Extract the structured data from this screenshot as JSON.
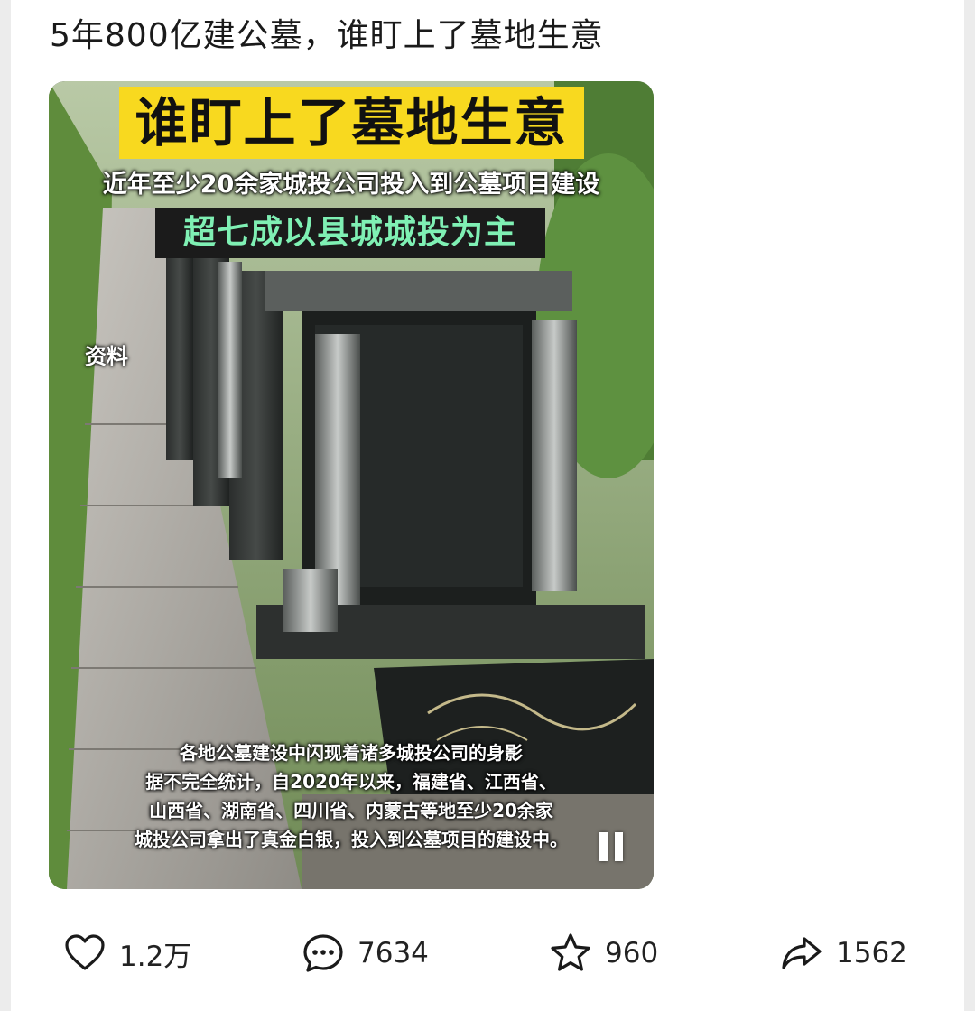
{
  "post": {
    "title": "5年800亿建公墓，谁盯上了墓地生意"
  },
  "video": {
    "headline": "谁盯上了墓地生意",
    "subtitle_line1": "近年至少20余家城投公司投入到公墓项目建设",
    "subtitle_line2": "超七成以县城城投为主",
    "source_tag": "资料",
    "caption_lines": [
      "各地公墓建设中闪现着诸多城投公司的身影",
      "据不完全统计，自2020年以来，福建省、江西省、",
      "山西省、湖南省、四川省、内蒙古等地至少20余家",
      "城投公司拿出了真金白银，投入到公墓项目的建设中。"
    ],
    "state": "playing"
  },
  "actions": {
    "like": {
      "icon": "heart-icon",
      "count": "1.2万"
    },
    "comment": {
      "icon": "comment-icon",
      "count": "7634"
    },
    "favorite": {
      "icon": "star-icon",
      "count": "960"
    },
    "share": {
      "icon": "share-icon",
      "count": "1562"
    }
  },
  "colors": {
    "headline_bg": "#f8d91f",
    "subtitle2_text": "#7ff0b4",
    "page_bg": "#ececec"
  }
}
